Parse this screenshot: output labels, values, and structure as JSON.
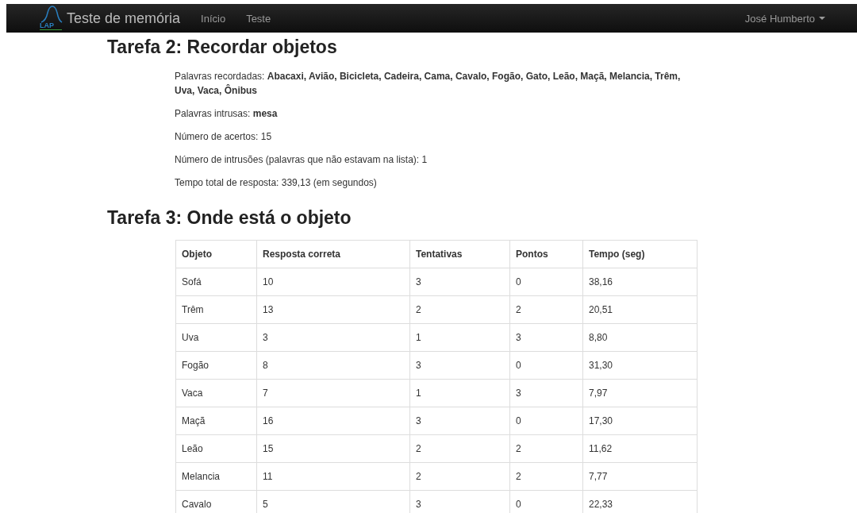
{
  "navbar": {
    "logo": {
      "main": "LAP"
    },
    "brand": "Teste de memória",
    "links": [
      {
        "label": "Início",
        "selected": false
      },
      {
        "label": "Teste",
        "selected": false
      }
    ],
    "user": "José Humberto"
  },
  "sections": [
    {
      "title": "Tarefa 2: Recordar objetos",
      "paragraphs": [
        "Palavras recordadas: **Abacaxi, Avião, Bicicleta, Cadeira, Cama, Cavalo, Fogão, Gato, Leão, Maçã, Melancia, Trêm, Uva, Vaca, Ônibus**",
        "Palavras intrusas: **mesa**",
        "Número de acertos: 15",
        "Número de intrusões (palavras que não estavam na lista): 1",
        "Tempo total de resposta: 339,13 (em segundos)"
      ]
    },
    {
      "title": "Tarefa 3: Onde está o objeto",
      "table": {
        "columns": [
          "Objeto",
          "Resposta correta",
          "Tentativas",
          "Pontos",
          "Tempo (seg)"
        ],
        "rows": [
          [
            "Sofá",
            "10",
            "3",
            "0",
            "38,16"
          ],
          [
            "Trêm",
            "13",
            "2",
            "2",
            "20,51"
          ],
          [
            "Uva",
            "3",
            "1",
            "3",
            "8,80"
          ],
          [
            "Fogão",
            "8",
            "3",
            "0",
            "31,30"
          ],
          [
            "Vaca",
            "7",
            "1",
            "3",
            "7,97"
          ],
          [
            "Maçã",
            "16",
            "3",
            "0",
            "17,30"
          ],
          [
            "Leão",
            "15",
            "2",
            "2",
            "11,62"
          ],
          [
            "Melancia",
            "11",
            "2",
            "2",
            "7,77"
          ],
          [
            "Cavalo",
            "5",
            "3",
            "0",
            "22,33"
          ]
        ]
      }
    }
  ]
}
